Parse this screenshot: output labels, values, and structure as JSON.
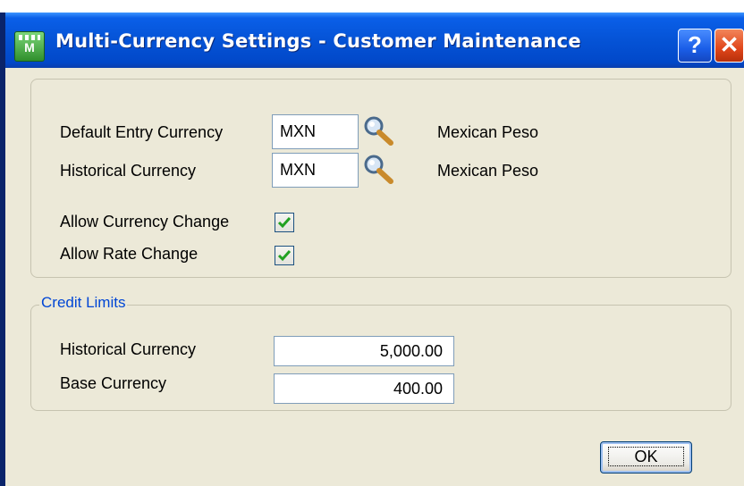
{
  "window": {
    "title": "Multi-Currency Settings - Customer Maintenance",
    "help_label": "?",
    "close_label": "✕"
  },
  "currency": {
    "default_entry": {
      "label": "Default Entry Currency",
      "code": "MXN",
      "name": "Mexican Peso"
    },
    "historical": {
      "label": "Historical Currency",
      "code": "MXN",
      "name": "Mexican Peso"
    },
    "allow_currency_change": {
      "label": "Allow Currency Change",
      "checked": true
    },
    "allow_rate_change": {
      "label": "Allow Rate Change",
      "checked": true
    }
  },
  "credit_limits": {
    "legend": "Credit Limits",
    "historical": {
      "label": "Historical Currency",
      "value": "5,000.00"
    },
    "base": {
      "label": "Base Currency",
      "value": "400.00"
    }
  },
  "buttons": {
    "ok_label": "OK"
  },
  "icons": {
    "app": "app-icon",
    "lookup": "magnifier-icon",
    "check": "checkmark-icon"
  },
  "colors": {
    "titlebar": "#0553d6",
    "dialog_bg": "#ece9d8",
    "legend": "#0046d5",
    "check": "#21a121"
  }
}
